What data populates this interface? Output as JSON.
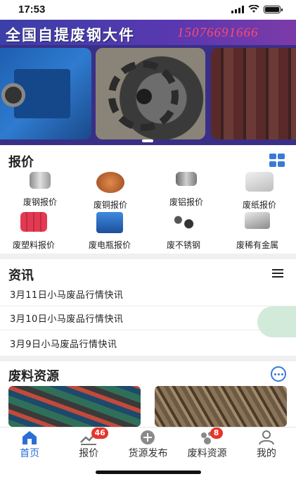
{
  "status_bar": {
    "time": "17:53"
  },
  "banner": {
    "headline": "全国自提废钢大件",
    "phone": "15076691666"
  },
  "price_section": {
    "title": "报价",
    "items": [
      {
        "label": "废钢报价",
        "icon": "steel-pipe-icon",
        "color": "#b9b9b9"
      },
      {
        "label": "废铜报价",
        "icon": "copper-wire-icon",
        "color": "#c4672f"
      },
      {
        "label": "废铝报价",
        "icon": "aluminum-roll-icon",
        "color": "#9a9a9a"
      },
      {
        "label": "废纸报价",
        "icon": "paper-bundle-icon",
        "color": "#d8d8d8"
      },
      {
        "label": "废塑料报价",
        "icon": "plastic-bales-icon",
        "color": "#d8344a"
      },
      {
        "label": "废电瓶报价",
        "icon": "battery-icon",
        "color": "#2a6fc9"
      },
      {
        "label": "废不锈钢",
        "icon": "stainless-parts-icon",
        "color": "#3b3b3b"
      },
      {
        "label": "废稀有金属",
        "icon": "metal-ingot-icon",
        "color": "#a8a8a8"
      }
    ]
  },
  "news_section": {
    "title": "资讯",
    "items": [
      "3月11日小马废品行情快讯",
      "3月10日小马废品行情快讯",
      "3月9日小马废品行情快讯"
    ]
  },
  "waste_section": {
    "title": "废料资源"
  },
  "tabbar": {
    "tabs": [
      {
        "label": "首页",
        "icon": "home-icon",
        "active": true
      },
      {
        "label": "报价",
        "icon": "chart-trend-icon",
        "badge": "46"
      },
      {
        "label": "货源发布",
        "icon": "plus-circle-icon"
      },
      {
        "label": "废料资源",
        "icon": "resources-icon",
        "badge": "8"
      },
      {
        "label": "我的",
        "icon": "user-icon"
      }
    ]
  },
  "colors": {
    "accent": "#2b6fd6",
    "badge": "#e8352a",
    "banner": "#4a3ab0"
  }
}
